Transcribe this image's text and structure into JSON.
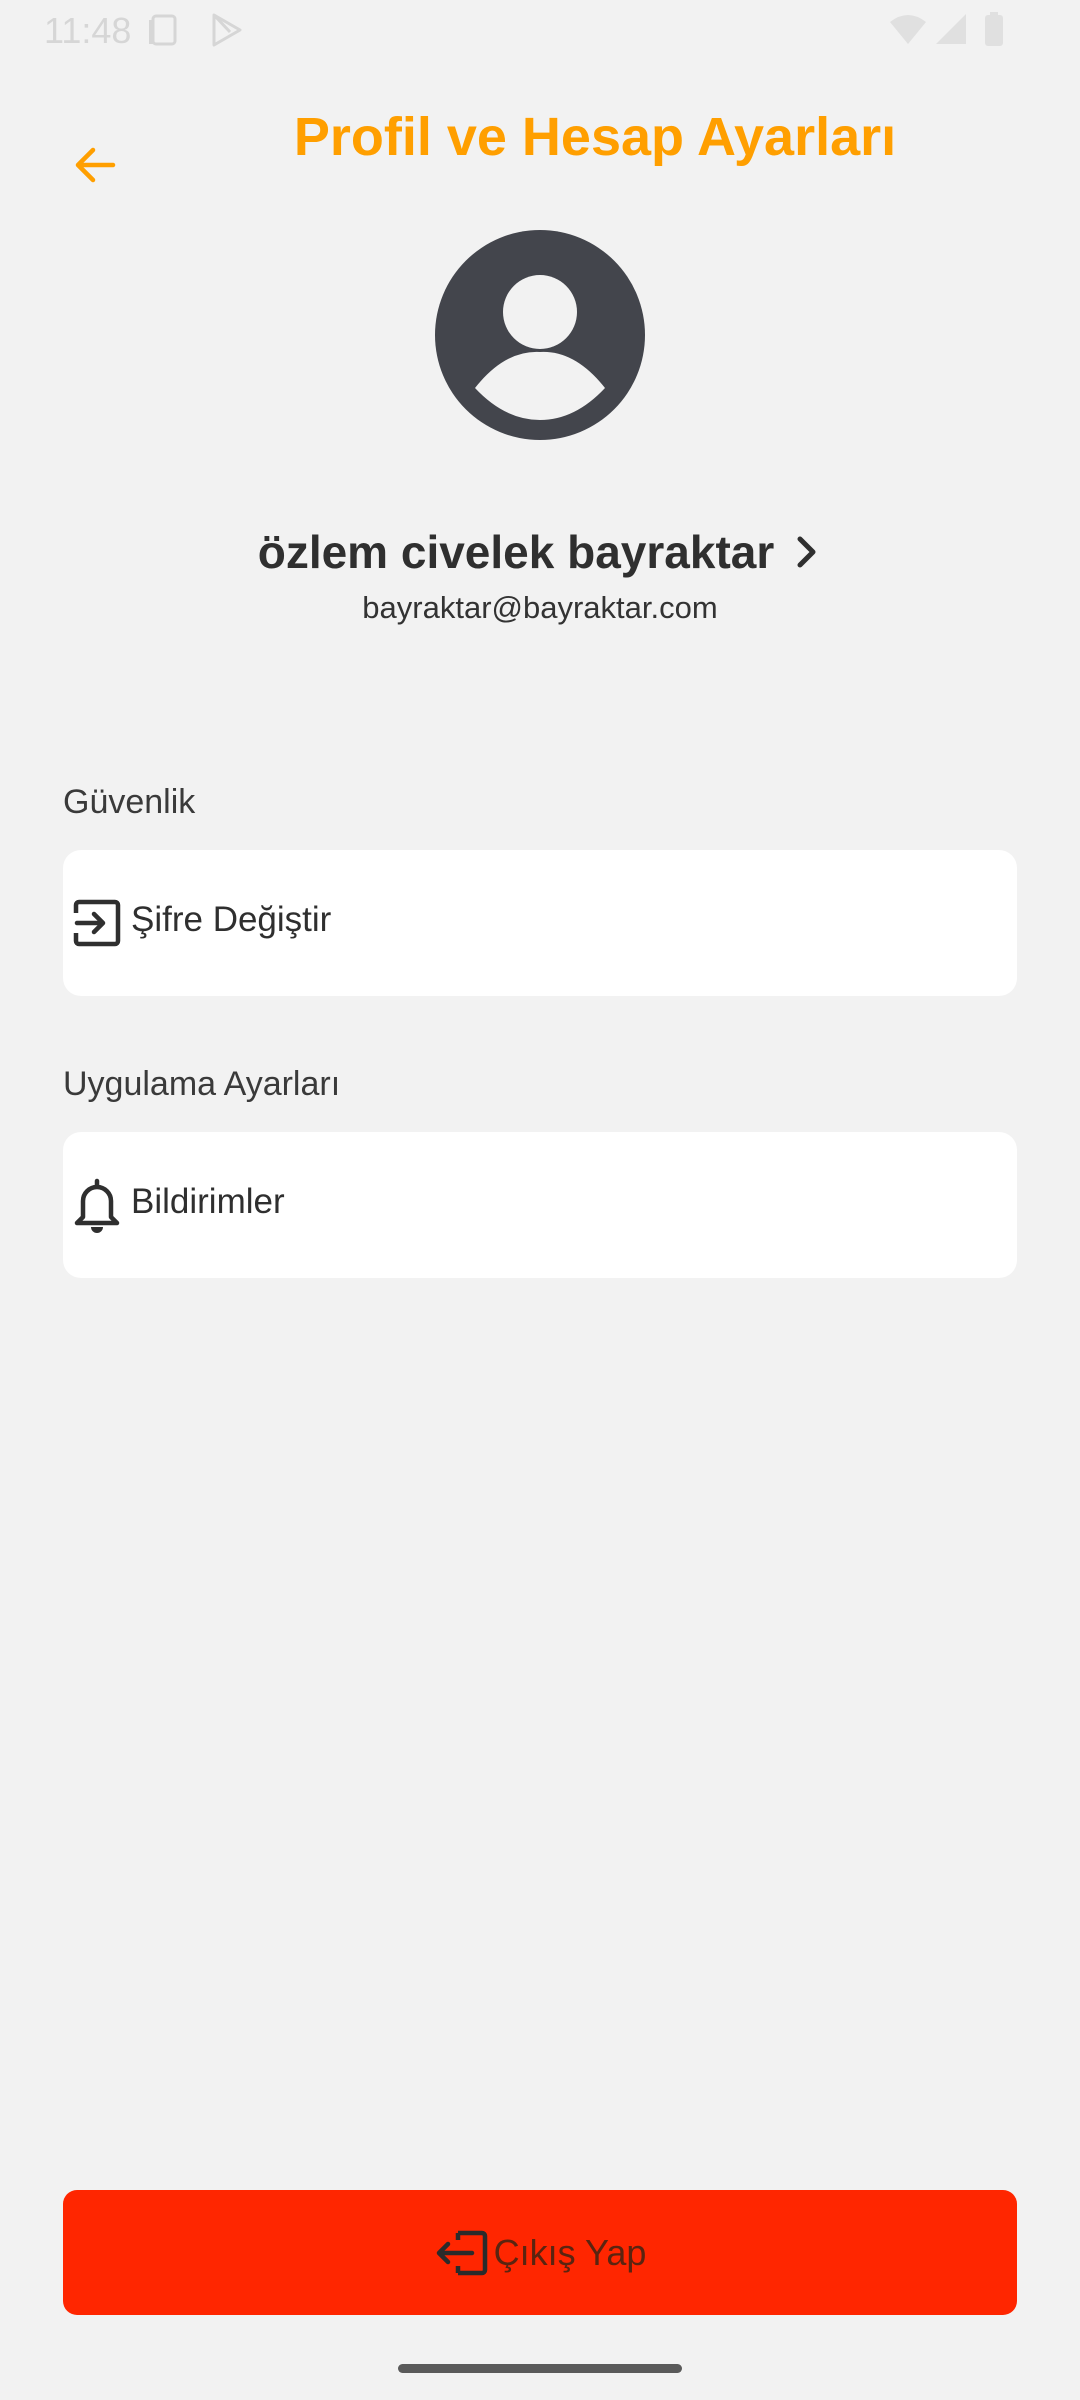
{
  "status_bar": {
    "time": "11:48",
    "icons": [
      "clipboard-icon",
      "play-store-icon",
      "wifi-icon",
      "signal-icon",
      "battery-icon"
    ]
  },
  "header": {
    "title": "Profil ve Hesap Ayarları",
    "back_icon": "arrow-left-icon",
    "accent_color": "#ff9f00"
  },
  "profile": {
    "avatar_icon": "account-circle-icon",
    "name": "özlem civelek bayraktar",
    "email": "bayraktar@bayraktar.com"
  },
  "sections": {
    "security": {
      "label": "Güvenlik",
      "items": [
        {
          "label": "Şifre Değiştir",
          "icon": "login-icon"
        }
      ]
    },
    "app_settings": {
      "label": "Uygulama Ayarları",
      "items": [
        {
          "label": "Bildirimler",
          "icon": "bell-icon"
        }
      ]
    }
  },
  "logout": {
    "label": "Çıkış Yap",
    "icon": "logout-icon",
    "color": "#ff2600"
  }
}
